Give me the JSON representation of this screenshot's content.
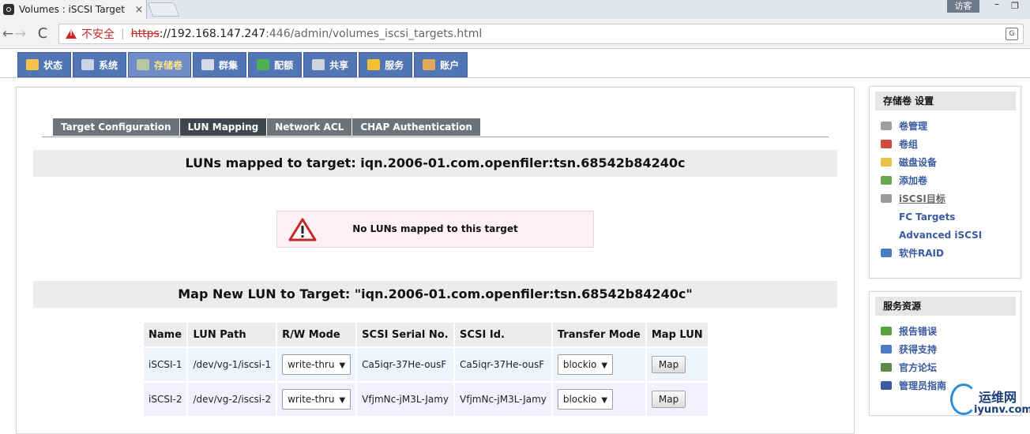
{
  "browser": {
    "tab_title": "Volumes : iSCSI Target",
    "tab_close": "×",
    "user_badge": "访客",
    "win_min": "–",
    "win_max": "❐",
    "insecure_label": "不安全",
    "url_sep": "|",
    "url_scheme": "https",
    "url_host": "://192.168.147.247",
    "url_path": ":446/admin/volumes_iscsi_targets.html",
    "back": "←",
    "forward": "→",
    "reload": "C",
    "translate": "G"
  },
  "appnav": {
    "items": [
      {
        "label": "状态",
        "icon": "status-icon",
        "color": "#f5c24a"
      },
      {
        "label": "系统",
        "icon": "system-icon",
        "color": "#c9d3e3"
      },
      {
        "label": "存储卷",
        "icon": "volumes-icon",
        "color": "#b8c8a0"
      },
      {
        "label": "群集",
        "icon": "cluster-icon",
        "color": "#d5dbe6"
      },
      {
        "label": "配额",
        "icon": "quota-icon",
        "color": "#4caf50"
      },
      {
        "label": "共享",
        "icon": "shares-icon",
        "color": "#d0d4da"
      },
      {
        "label": "服务",
        "icon": "services-icon",
        "color": "#f2c12e"
      },
      {
        "label": "账户",
        "icon": "accounts-icon",
        "color": "#e3a95a"
      }
    ],
    "active_index": 2
  },
  "subtabs": [
    {
      "label": "Target Configuration"
    },
    {
      "label": "LUN Mapping"
    },
    {
      "label": "Network ACL"
    },
    {
      "label": "CHAP Authentication"
    }
  ],
  "sections": {
    "mapped_title": "LUNs mapped to target: iqn.2006-01.com.openfiler:tsn.68542b84240c",
    "notice": "No LUNs mapped to this target",
    "map_new_title": "Map New LUN to Target: \"iqn.2006-01.com.openfiler:tsn.68542b84240c\""
  },
  "lun_table": {
    "headers": [
      "Name",
      "LUN Path",
      "R/W Mode",
      "SCSI Serial No.",
      "SCSI Id.",
      "Transfer Mode",
      "Map LUN"
    ],
    "rows": [
      {
        "name": "iSCSI-1",
        "path": "/dev/vg-1/iscsi-1",
        "rw_mode": "write-thru",
        "serial": "Ca5iqr-37He-ousF",
        "scsi_id": "Ca5iqr-37He-ousF",
        "transfer": "blockio",
        "map_label": "Map"
      },
      {
        "name": "iSCSI-2",
        "path": "/dev/vg-2/iscsi-2",
        "rw_mode": "write-thru",
        "serial": "VfjmNc-jM3L-Jamy",
        "scsi_id": "VfjmNc-jM3L-Jamy",
        "transfer": "blockio",
        "map_label": "Map"
      }
    ]
  },
  "sidebar_volume": {
    "title": "存储卷 设置",
    "items": [
      {
        "label": "卷管理",
        "icon": "volume-mgmt-icon",
        "color": "#a0a0a0"
      },
      {
        "label": "卷组",
        "icon": "volume-group-icon",
        "color": "#d04a3a"
      },
      {
        "label": "磁盘设备",
        "icon": "disk-icon",
        "color": "#e8c248"
      },
      {
        "label": "添加卷",
        "icon": "add-volume-icon",
        "color": "#6aa84f"
      },
      {
        "label": "iSCSI目标",
        "icon": "iscsi-icon",
        "color": "#9a9a9a"
      },
      {
        "label": "FC Targets",
        "icon": "fc-targets-icon",
        "color": "#ffffff"
      },
      {
        "label": "Advanced iSCSI",
        "icon": "advanced-iscsi-icon",
        "color": "#ffffff"
      },
      {
        "label": "软件RAID",
        "icon": "raid-icon",
        "color": "#4a7ac8"
      }
    ]
  },
  "sidebar_support": {
    "title": "服务资源",
    "items": [
      {
        "label": "报告错误",
        "icon": "bug-icon",
        "color": "#5aa23c"
      },
      {
        "label": "获得支持",
        "icon": "support-icon",
        "color": "#4a7ac8"
      },
      {
        "label": "官方论坛",
        "icon": "forum-icon",
        "color": "#5a8a4c"
      },
      {
        "label": "管理员指南",
        "icon": "guide-icon",
        "color": "#3a5ba0"
      }
    ]
  },
  "watermark": {
    "cn": "运维网",
    "en": "iyunv.com"
  }
}
